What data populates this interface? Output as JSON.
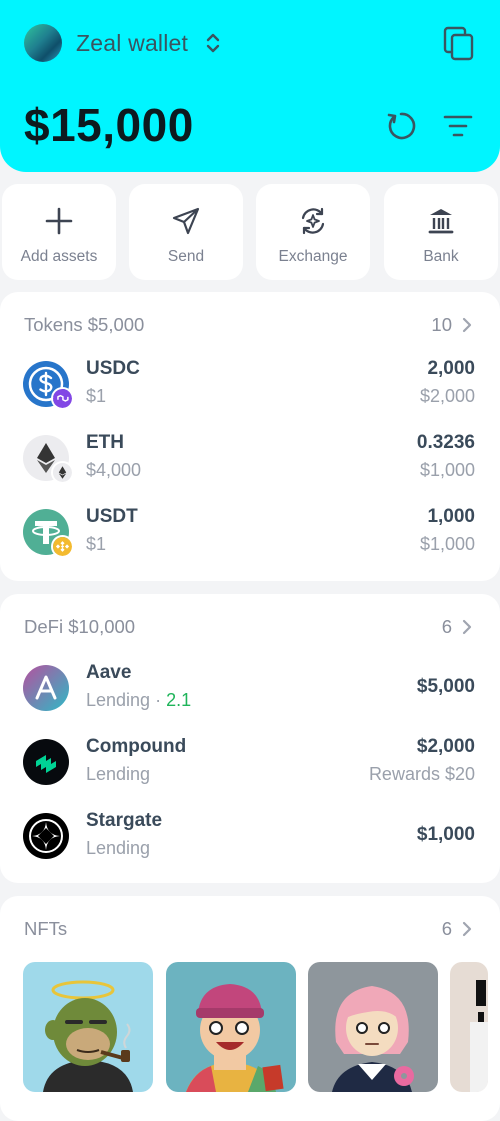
{
  "wallet": {
    "name": "Zeal wallet",
    "balance": "$15,000"
  },
  "actions": [
    {
      "label": "Add assets",
      "icon": "plus-icon"
    },
    {
      "label": "Send",
      "icon": "send-icon"
    },
    {
      "label": "Exchange",
      "icon": "exchange-icon"
    },
    {
      "label": "Bank",
      "icon": "bank-icon"
    }
  ],
  "tokens": {
    "heading": "Tokens $5,000",
    "count": "10",
    "items": [
      {
        "symbol": "USDC",
        "price": "$1",
        "amount": "2,000",
        "value": "$2,000",
        "icon": "usdc-icon",
        "network_icon": "polygon-icon"
      },
      {
        "symbol": "ETH",
        "price": "$4,000",
        "amount": "0.3236",
        "value": "$1,000",
        "icon": "eth-icon",
        "network_icon": "ethereum-icon"
      },
      {
        "symbol": "USDT",
        "price": "$1",
        "amount": "1,000",
        "value": "$1,000",
        "icon": "usdt-icon",
        "network_icon": "bnb-icon"
      }
    ]
  },
  "defi": {
    "heading": "DeFi $10,000",
    "count": "6",
    "items": [
      {
        "name": "Aave",
        "type": "Lending",
        "apy": "2.1",
        "value": "$5,000",
        "icon": "aave-icon"
      },
      {
        "name": "Compound",
        "type": "Lending",
        "value": "$2,000",
        "rewards": "Rewards $20",
        "icon": "compound-icon"
      },
      {
        "name": "Stargate",
        "type": "Lending",
        "value": "$1,000",
        "icon": "stargate-icon"
      }
    ]
  },
  "nfts": {
    "heading": "NFTs",
    "count": "6",
    "items": [
      "ape-nft-image",
      "beanie-nft-image",
      "pink-hair-nft-image",
      "partial-nft-image"
    ]
  },
  "colors": {
    "header": "#00f5ff",
    "positive": "#1fb45a"
  }
}
